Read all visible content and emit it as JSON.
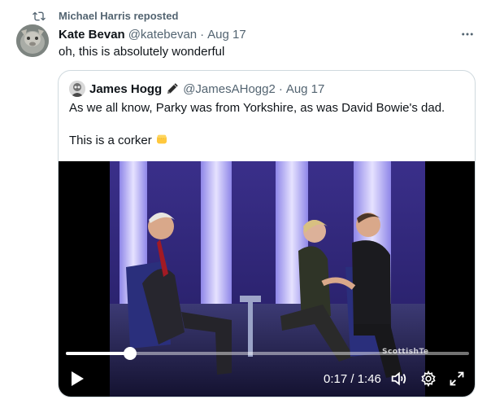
{
  "repost": {
    "text": "Michael Harris reposted",
    "icon": "repost-icon"
  },
  "tweet": {
    "name": "Kate Bevan",
    "handle": "@katebevan",
    "dot": "·",
    "date": "Aug 17",
    "text": "oh, this is absolutely wonderful",
    "more_icon": "more-icon"
  },
  "quote": {
    "name": "James Hogg",
    "handle": "@JamesAHogg2",
    "dot": "·",
    "date": "Aug 17",
    "line1": "As we all know, Parky was from Yorkshire, as was David Bowie's dad.",
    "line2": "This is a corker"
  },
  "video": {
    "time": "0:17 / 1:46",
    "progress_fraction": 0.16,
    "watermark": "ScottishTe"
  },
  "colors": {
    "text": "#0f1419",
    "secondary": "#536471",
    "border": "#cfd9de"
  }
}
